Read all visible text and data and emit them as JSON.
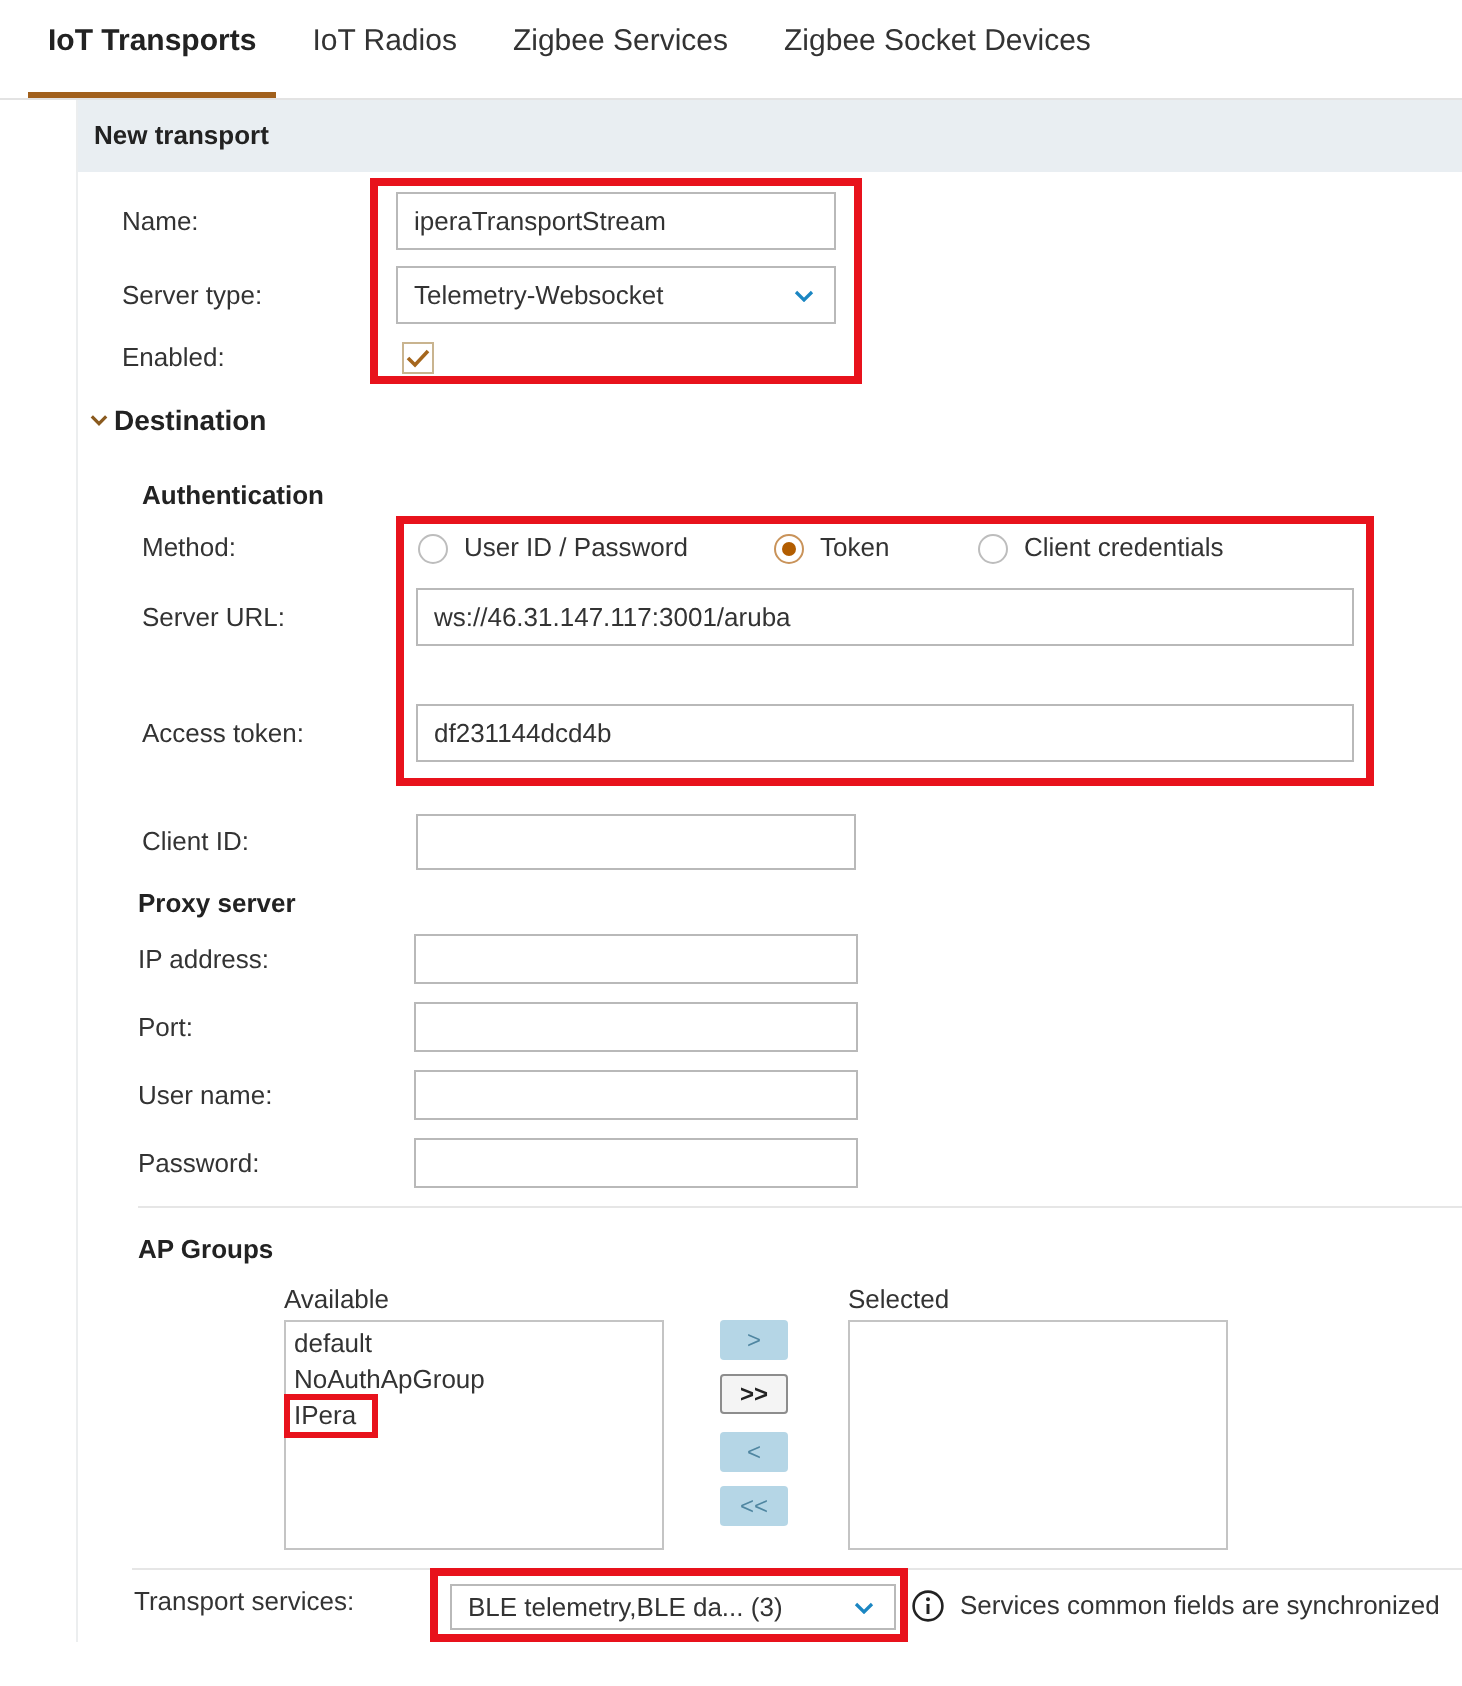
{
  "tabs": [
    {
      "label": "IoT Transports",
      "selected": true
    },
    {
      "label": "IoT Radios",
      "selected": false
    },
    {
      "label": "Zigbee Services",
      "selected": false
    },
    {
      "label": "Zigbee Socket Devices",
      "selected": false
    }
  ],
  "panel": {
    "title": "New transport",
    "general": {
      "highlighted": true,
      "fields": [
        {
          "kind": "text",
          "label": "Name:",
          "value": "iperaTransportStream"
        },
        {
          "kind": "select",
          "label": "Server type:",
          "value": "Telemetry-Websocket"
        },
        {
          "kind": "checkbox",
          "label": "Enabled:",
          "checked": true
        }
      ]
    },
    "destination": {
      "title": "Destination",
      "expanded": true,
      "authentication": {
        "title": "Authentication",
        "highlighted": true,
        "method": {
          "label": "Method:",
          "options": [
            {
              "label": "User ID / Password",
              "selected": false
            },
            {
              "label": "Token",
              "selected": true
            },
            {
              "label": "Client credentials",
              "selected": false
            }
          ]
        },
        "server_url": {
          "label": "Server URL:",
          "value": "ws://46.31.147.117:3001/aruba"
        },
        "access_token": {
          "label": "Access token:",
          "value": "df231144dcd4b"
        }
      },
      "client_id": {
        "label": "Client ID:"
      },
      "proxy_server": {
        "title": "Proxy server",
        "fields": [
          {
            "label": "IP address:"
          },
          {
            "label": "Port:"
          },
          {
            "label": "User name:"
          },
          {
            "label": "Password:"
          }
        ]
      },
      "ap_groups": {
        "title": "AP Groups",
        "available": {
          "label": "Available",
          "items": [
            {
              "label": "default",
              "highlighted": false
            },
            {
              "label": "NoAuthApGroup",
              "highlighted": false
            },
            {
              "label": "IPera",
              "highlighted": true
            }
          ]
        },
        "move_buttons": [
          {
            "label": ">",
            "disabled": true
          },
          {
            "label": ">>",
            "disabled": false
          },
          {
            "label": "<",
            "disabled": true
          },
          {
            "label": "<<",
            "disabled": true
          }
        ],
        "selected": {
          "label": "Selected"
        }
      }
    },
    "transport_services": {
      "label": "Transport services:",
      "value": "BLE telemetry,BLE da... (3)",
      "highlighted": true,
      "note": "Services common fields are synchronized"
    }
  }
}
